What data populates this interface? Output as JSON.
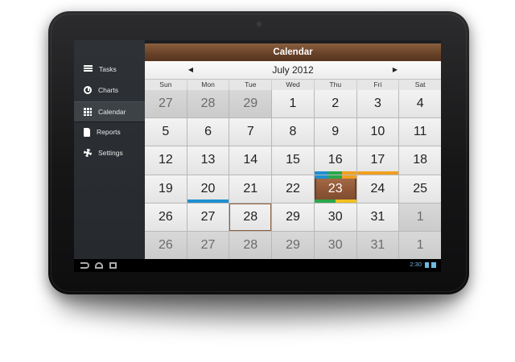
{
  "window": {
    "title": "Calendar"
  },
  "sidebar": {
    "items": [
      {
        "label": "Tasks",
        "icon": "tasks-icon",
        "active": false
      },
      {
        "label": "Charts",
        "icon": "charts-icon",
        "active": false
      },
      {
        "label": "Calendar",
        "icon": "calendar-icon",
        "active": true
      },
      {
        "label": "Reports",
        "icon": "reports-icon",
        "active": false
      },
      {
        "label": "Settings",
        "icon": "settings-icon",
        "active": false
      }
    ]
  },
  "calendar": {
    "month_label": "July 2012",
    "prev_arrow": "◀",
    "next_arrow": "▶",
    "weekdays": [
      "Sun",
      "Mon",
      "Tue",
      "Wed",
      "Thu",
      "Fri",
      "Sat"
    ],
    "weeks": [
      [
        "27",
        "28",
        "29",
        "1",
        "2",
        "3",
        "4"
      ],
      [
        "5",
        "6",
        "7",
        "8",
        "9",
        "10",
        "11"
      ],
      [
        "12",
        "13",
        "14",
        "15",
        "16",
        "17",
        "18"
      ],
      [
        "19",
        "20",
        "21",
        "22",
        "23",
        "24",
        "25"
      ],
      [
        "26",
        "27",
        "28",
        "29",
        "30",
        "31",
        "1"
      ],
      [
        "26",
        "27",
        "28",
        "29",
        "30",
        "31",
        "1"
      ]
    ],
    "other_month_cells": [
      [
        0,
        0
      ],
      [
        0,
        1
      ],
      [
        0,
        2
      ],
      [
        4,
        6
      ],
      [
        5,
        0
      ],
      [
        5,
        1
      ],
      [
        5,
        2
      ],
      [
        5,
        3
      ],
      [
        5,
        4
      ],
      [
        5,
        5
      ],
      [
        5,
        6
      ]
    ],
    "today_cell": [
      3,
      4
    ],
    "selected_cell": [
      4,
      2
    ],
    "event_strips": [
      {
        "cell": [
          2,
          4
        ],
        "position": "bottom",
        "colors": [
          "#1e90d0",
          "#2aa84a",
          "#f0a020"
        ]
      },
      {
        "cell": [
          2,
          5
        ],
        "position": "bottom",
        "colors": [
          "#f0a020"
        ]
      },
      {
        "cell": [
          3,
          4
        ],
        "position": "bottom",
        "colors": [
          "#2aa84a",
          "#f0c020"
        ]
      },
      {
        "cell": [
          3,
          1
        ],
        "position": "bottom",
        "colors": [
          "#1e90d0"
        ]
      }
    ],
    "colors": {
      "header_brown": "#6a4329",
      "today_brown": "#8c5535"
    }
  },
  "statusbar": {
    "time": "2:30"
  }
}
